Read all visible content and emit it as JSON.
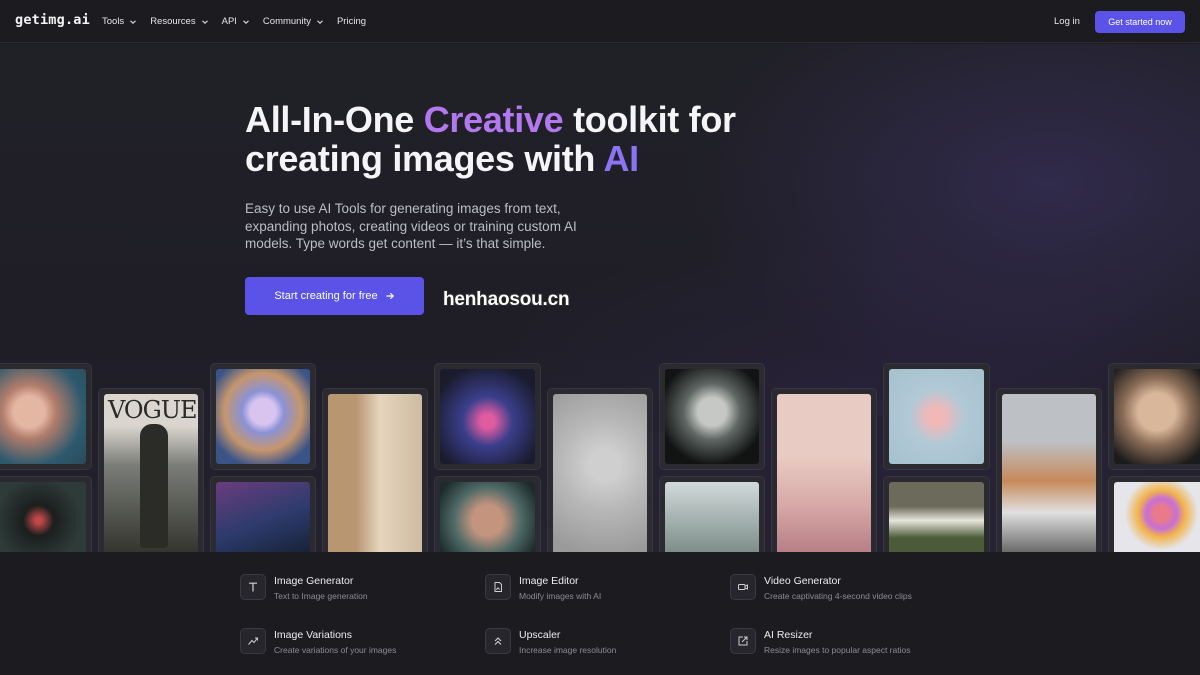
{
  "nav": {
    "logo": "getimg.ai",
    "links": [
      {
        "label": "Tools",
        "dropdown": true
      },
      {
        "label": "Resources",
        "dropdown": true
      },
      {
        "label": "API",
        "dropdown": true
      },
      {
        "label": "Community",
        "dropdown": true
      },
      {
        "label": "Pricing",
        "dropdown": false
      }
    ],
    "login": "Log in",
    "cta": "Get started now"
  },
  "hero": {
    "title_part1": "All-In-One ",
    "title_highlight1": "Creative",
    "title_part2": " toolkit for creating images with ",
    "title_highlight2": "AI",
    "subtitle": "Easy to use AI Tools for generating images from text, expanding photos, creating videos or training custom AI models. Type words get content — it’s that simple.",
    "button": "Start creating for free",
    "watermark": "henhaosou.cn"
  },
  "colors": {
    "accent": "#5b52e8",
    "highlight_purple": "#b377f0",
    "highlight_violet": "#8a74f4"
  },
  "features": [
    {
      "icon": "text-icon",
      "title": "Image Generator",
      "desc": "Text to Image generation"
    },
    {
      "icon": "image-edit-icon",
      "title": "Image Editor",
      "desc": "Modify images with AI"
    },
    {
      "icon": "video-camera-icon",
      "title": "Video Generator",
      "desc": "Create captivating 4-second video clips"
    },
    {
      "icon": "shuffle-icon",
      "title": "Image Variations",
      "desc": "Create variations of your images"
    },
    {
      "icon": "chevrons-up-icon",
      "title": "Upscaler",
      "desc": "Increase image resolution"
    },
    {
      "icon": "resize-icon",
      "title": "AI Resizer",
      "desc": "Resize images to popular aspect ratios"
    }
  ],
  "gallery": {
    "vogue_text": "VOGUE"
  }
}
